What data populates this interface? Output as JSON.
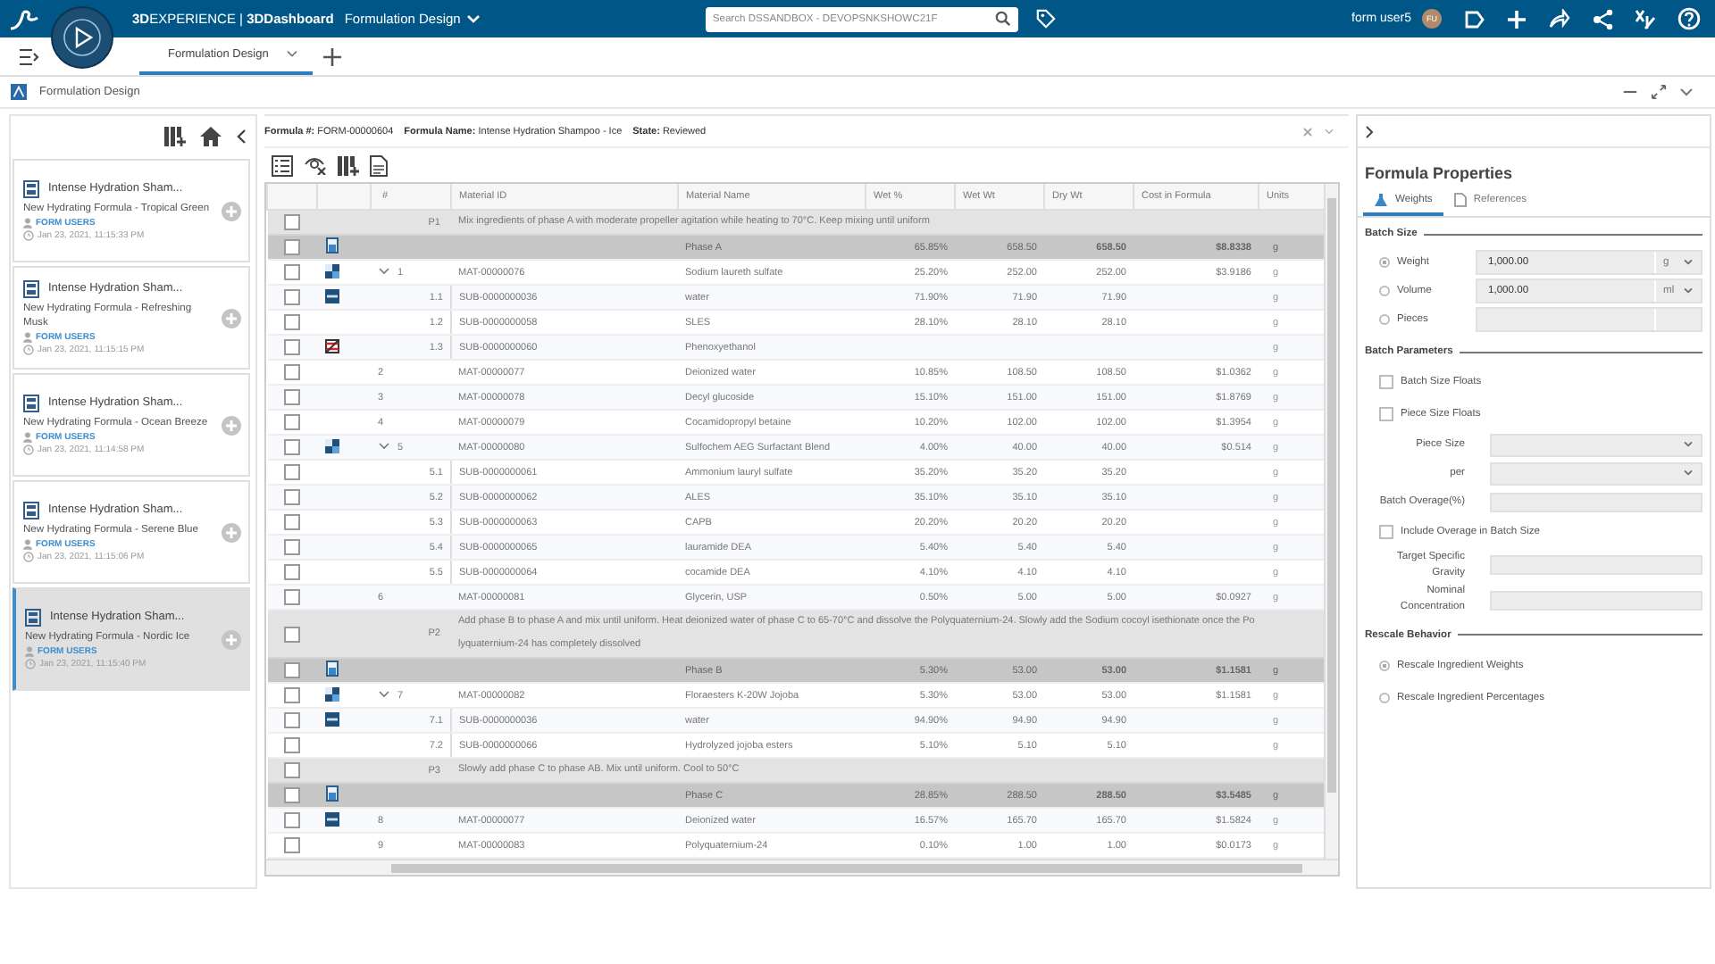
{
  "top_bar": {
    "brand": "**3D**EXPERIENCE | **3DDashboard**",
    "dashboard": "Formulation Design",
    "search": {
      "placeholder": "Search DSSANDBOX - DEVOPSNKSHOWC21F"
    },
    "user": "form user5",
    "avatar": "FU"
  },
  "tabs": [
    {
      "label": "Formulation Design",
      "selected": true
    }
  ],
  "app": {
    "title": "Formulation Design"
  },
  "formulas": [
    {
      "title": "Intense Hydration Sham...",
      "subtitle": "New Hydrating Formula - Tropical Green",
      "owner": "FORM USERS",
      "date": "Jan 23, 2021, 11:15:33 PM",
      "selected": false
    },
    {
      "title": "Intense Hydration Sham...",
      "subtitle": "New Hydrating Formula - Refreshing Musk",
      "owner": "FORM USERS",
      "date": "Jan 23, 2021, 11:15:15 PM",
      "selected": false
    },
    {
      "title": "Intense Hydration Sham...",
      "subtitle": "New Hydrating Formula - Ocean Breeze",
      "owner": "FORM USERS",
      "date": "Jan 23, 2021, 11:14:58 PM",
      "selected": false
    },
    {
      "title": "Intense Hydration Sham...",
      "subtitle": "New Hydrating Formula - Serene Blue",
      "owner": "FORM USERS",
      "date": "Jan 23, 2021, 11:15:06 PM",
      "selected": false
    },
    {
      "title": "Intense Hydration Sham...",
      "subtitle": "New Hydrating Formula - Nordic Ice",
      "owner": "FORM USERS",
      "date": "Jan 23, 2021, 11:15:40 PM",
      "selected": true
    }
  ],
  "header": {
    "fields": [
      {
        "label": "Formula #:",
        "value": "FORM-00000604"
      },
      {
        "label": "Formula Name:",
        "value": "Intense Hydration Shampoo - Ice"
      },
      {
        "label": "State:",
        "value": "Reviewed"
      }
    ]
  },
  "table": {
    "columns": [
      "#",
      "Material ID",
      "Material Name",
      "Wet %",
      "Wet Wt",
      "Dry Wt",
      "Cost in Formula",
      "Units"
    ],
    "rows": [
      {
        "kind": "step",
        "checked": false,
        "number": "P1",
        "lines": [
          "Mix ingredients of phase A with moderate propeller agitation while heating to 70°C. Keep mixing until uniform"
        ]
      },
      {
        "kind": "phase",
        "checked": false,
        "name": "Phase A",
        "wet_pct": "65.85%",
        "wet_wt": "658.50",
        "dry_wt": "658.50",
        "cost": "$8.8338",
        "units": "g"
      },
      {
        "kind": "mixture",
        "checked": false,
        "expanded": true,
        "number": "1",
        "id": "MAT-00000076",
        "name": "Sodium laureth sulfate",
        "wet_pct": "25.20%",
        "wet_wt": "252.00",
        "dry_wt": "252.00",
        "cost": "$3.9186",
        "units": "g",
        "children": [
          {
            "kind": "substance",
            "checked": false,
            "number": "1.1",
            "id": "SUB-0000000036",
            "name": "water",
            "wet_pct": "71.90%",
            "wet_wt": "71.90",
            "dry_wt": "71.90",
            "units": "g"
          },
          {
            "kind": "material",
            "checked": false,
            "number": "1.2",
            "id": "SUB-0000000058",
            "name": "SLES",
            "wet_pct": "28.10%",
            "wet_wt": "28.10",
            "dry_wt": "28.10",
            "units": "g"
          },
          {
            "kind": "flagged",
            "checked": false,
            "number": "1.3",
            "id": "SUB-0000000060",
            "name": "Phenoxyethanol",
            "units": "g"
          }
        ]
      },
      {
        "kind": "material",
        "checked": false,
        "number": "2",
        "id": "MAT-00000077",
        "name": "Deionized water",
        "wet_pct": "10.85%",
        "wet_wt": "108.50",
        "dry_wt": "108.50",
        "cost": "$1.0362",
        "units": "g"
      },
      {
        "kind": "material",
        "checked": false,
        "number": "3",
        "id": "MAT-00000078",
        "name": "Decyl glucoside",
        "wet_pct": "15.10%",
        "wet_wt": "151.00",
        "dry_wt": "151.00",
        "cost": "$1.8769",
        "units": "g"
      },
      {
        "kind": "material",
        "checked": false,
        "number": "4",
        "id": "MAT-00000079",
        "name": "Cocamidopropyl betaine",
        "wet_pct": "10.20%",
        "wet_wt": "102.00",
        "dry_wt": "102.00",
        "cost": "$1.3954",
        "units": "g"
      },
      {
        "kind": "mixture",
        "checked": false,
        "expanded": true,
        "number": "5",
        "id": "MAT-00000080",
        "name": "Sulfochem AEG Surfactant Blend",
        "wet_pct": "4.00%",
        "wet_wt": "40.00",
        "dry_wt": "40.00",
        "cost": "$0.514",
        "units": "g",
        "children": [
          {
            "kind": "material",
            "checked": false,
            "number": "5.1",
            "id": "SUB-0000000061",
            "name": "Ammonium lauryl sulfate",
            "wet_pct": "35.20%",
            "wet_wt": "35.20",
            "dry_wt": "35.20",
            "units": "g"
          },
          {
            "kind": "material",
            "checked": false,
            "number": "5.2",
            "id": "SUB-0000000062",
            "name": "ALES",
            "wet_pct": "35.10%",
            "wet_wt": "35.10",
            "dry_wt": "35.10",
            "units": "g"
          },
          {
            "kind": "material",
            "checked": false,
            "number": "5.3",
            "id": "SUB-0000000063",
            "name": "CAPB",
            "wet_pct": "20.20%",
            "wet_wt": "20.20",
            "dry_wt": "20.20",
            "units": "g"
          },
          {
            "kind": "material",
            "checked": false,
            "number": "5.4",
            "id": "SUB-0000000065",
            "name": "lauramide DEA",
            "wet_pct": "5.40%",
            "wet_wt": "5.40",
            "dry_wt": "5.40",
            "units": "g"
          },
          {
            "kind": "material",
            "checked": false,
            "number": "5.5",
            "id": "SUB-0000000064",
            "name": "cocamide DEA",
            "wet_pct": "4.10%",
            "wet_wt": "4.10",
            "dry_wt": "4.10",
            "units": "g"
          }
        ]
      },
      {
        "kind": "material",
        "checked": false,
        "number": "6",
        "id": "MAT-00000081",
        "name": "Glycerin, USP",
        "wet_pct": "0.50%",
        "wet_wt": "5.00",
        "dry_wt": "5.00",
        "cost": "$0.0927",
        "units": "g"
      },
      {
        "kind": "step",
        "checked": false,
        "number": "P2",
        "lines": [
          "Add phase B to phase A and mix until uniform. Heat deionized water of phase C to 65-70°C and dissolve the Polyquaternium-24. Slowly add the Sodium cocoyl isethionate once the Po",
          "lyquaternium-24 has completely dissolved"
        ]
      },
      {
        "kind": "phase",
        "checked": false,
        "name": "Phase B",
        "wet_pct": "5.30%",
        "wet_wt": "53.00",
        "dry_wt": "53.00",
        "cost": "$1.1581",
        "units": "g"
      },
      {
        "kind": "mixture",
        "checked": false,
        "expanded": true,
        "number": "7",
        "id": "MAT-00000082",
        "name": "Floraesters K-20W Jojoba",
        "wet_pct": "5.30%",
        "wet_wt": "53.00",
        "dry_wt": "53.00",
        "cost": "$1.1581",
        "units": "g",
        "children": [
          {
            "kind": "substance",
            "checked": false,
            "number": "7.1",
            "id": "SUB-0000000036",
            "name": "water",
            "wet_pct": "94.90%",
            "wet_wt": "94.90",
            "dry_wt": "94.90",
            "units": "g"
          },
          {
            "kind": "material",
            "checked": false,
            "number": "7.2",
            "id": "SUB-0000000066",
            "name": "Hydrolyzed jojoba esters",
            "wet_pct": "5.10%",
            "wet_wt": "5.10",
            "dry_wt": "5.10",
            "units": "g"
          }
        ]
      },
      {
        "kind": "step",
        "checked": false,
        "number": "P3",
        "lines": [
          "Slowly add phase C to phase AB. Mix until uniform. Cool to 50°C"
        ]
      },
      {
        "kind": "phase",
        "checked": false,
        "name": "Phase C",
        "wet_pct": "28.85%",
        "wet_wt": "288.50",
        "dry_wt": "288.50",
        "cost": "$3.5485",
        "units": "g"
      },
      {
        "kind": "substance",
        "checked": false,
        "number": "8",
        "id": "MAT-00000077",
        "name": "Deionized water",
        "wet_pct": "16.57%",
        "wet_wt": "165.70",
        "dry_wt": "165.70",
        "cost": "$1.5824",
        "units": "g"
      },
      {
        "kind": "material",
        "checked": false,
        "number": "9",
        "id": "MAT-00000083",
        "name": "Polyquaternium-24",
        "wet_pct": "0.10%",
        "wet_wt": "1.00",
        "dry_wt": "1.00",
        "cost": "$0.0173",
        "units": "g"
      }
    ]
  },
  "properties": {
    "title": "Formula Properties",
    "tabs": [
      {
        "label": "Weights",
        "selected": true
      },
      {
        "label": "References",
        "selected": false
      }
    ],
    "sections": [
      {
        "title": "Batch Size",
        "fields": [
          {
            "kind": "radio-input",
            "label": "Weight",
            "selected": true,
            "value": "1,000.00",
            "unit": "g"
          },
          {
            "kind": "radio-input",
            "label": "Volume",
            "selected": false,
            "value": "1,000.00",
            "unit": "ml"
          },
          {
            "kind": "radio-input",
            "label": "Pieces",
            "selected": false
          }
        ]
      },
      {
        "title": "Batch Parameters",
        "fields": [
          {
            "kind": "checkbox",
            "label": "Batch Size Floats",
            "checked": false
          },
          {
            "kind": "checkbox",
            "label": "Piece Size Floats",
            "checked": false
          },
          {
            "kind": "select",
            "label": "Piece Size"
          },
          {
            "kind": "select",
            "label": "per"
          },
          {
            "kind": "input",
            "label": "Batch Overage(%)"
          },
          {
            "kind": "checkbox",
            "label": "Include Overage in Batch Size",
            "checked": false
          },
          {
            "kind": "input",
            "label": "Target Specific Gravity"
          },
          {
            "kind": "input",
            "label": "Nominal Concentration"
          }
        ]
      },
      {
        "title": "Rescale Behavior",
        "fields": [
          {
            "kind": "radio",
            "label": "Rescale Ingredient Weights",
            "selected": true
          },
          {
            "kind": "radio",
            "label": "Rescale Ingredient Percentages",
            "selected": false
          }
        ]
      }
    ]
  }
}
